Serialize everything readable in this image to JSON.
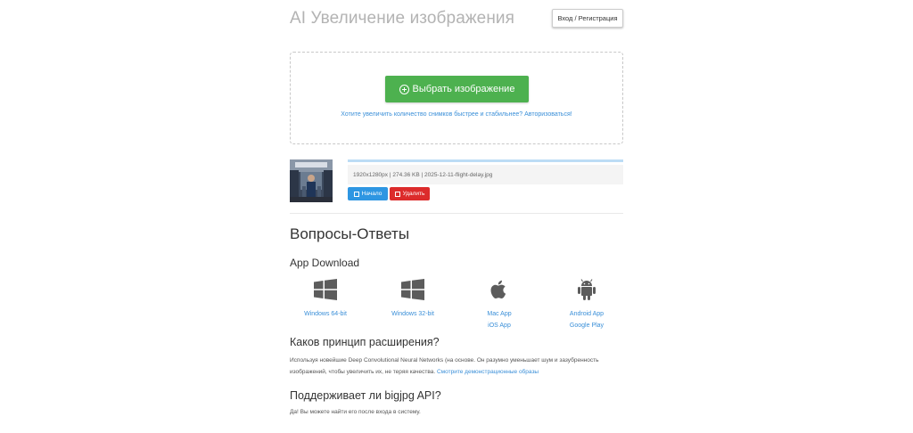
{
  "header": {
    "title": "AI Увеличение изображения",
    "login_label": "Вход / Регистрация"
  },
  "upload": {
    "choose_label": "Выбрать изображение",
    "hint": "Хотите увеличить количество снимков быстрее и стабильнее? Авторизоваться!"
  },
  "file": {
    "info": "1920x1280px | 274.36 KB | 2025-12-11-flight-delay.jpg",
    "progress": 1.0,
    "start_label": "Начало",
    "delete_label": "Удалить"
  },
  "faq": {
    "title": "Вопросы-Ответы",
    "app_download_title": "App Download",
    "apps": [
      {
        "icon": "windows-icon",
        "links": [
          "Windows 64-bit"
        ]
      },
      {
        "icon": "windows-icon",
        "links": [
          "Windows 32-bit"
        ]
      },
      {
        "icon": "apple-icon",
        "links": [
          "Mac App",
          "iOS App"
        ]
      },
      {
        "icon": "android-icon",
        "links": [
          "Android App",
          "Google Play"
        ]
      }
    ],
    "q1": {
      "title": "Каков принцип расширения?",
      "text": "Используя новейшие Deep Convolutional Neural Networks (на основе. Он разумно уменьшает шум и зазубренность изображений, чтобы увеличить их, не теряя качества. ",
      "link": "Смотрите демонстрационные образы"
    },
    "q2": {
      "title": "Поддерживает ли bigjpg API?",
      "text": "Да! Вы можете найти его после входа в систему."
    }
  },
  "colors": {
    "green": "#4db14f",
    "blue": "#2e96e2",
    "red": "#dc2b2b",
    "link": "#3a8fd8"
  }
}
